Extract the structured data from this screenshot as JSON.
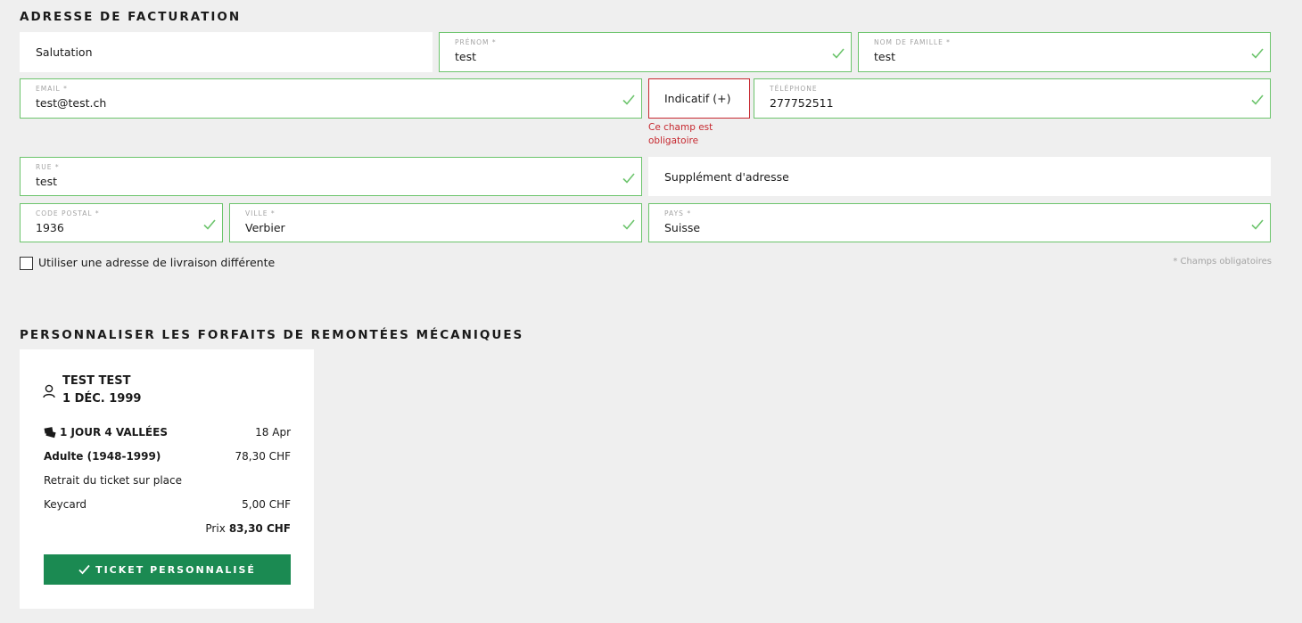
{
  "billing": {
    "title": "ADRESSE DE FACTURATION",
    "salutation": {
      "placeholder": "Salutation"
    },
    "first_name": {
      "label": "PRÉNOM *",
      "value": "test"
    },
    "last_name": {
      "label": "NOM DE FAMILLE *",
      "value": "test"
    },
    "email": {
      "label": "EMAIL *",
      "value": "test@test.ch"
    },
    "dial_code": {
      "placeholder": "Indicatif (+)",
      "error": "Ce champ est obligatoire"
    },
    "phone": {
      "label": "TÉLÉPHONE",
      "value": "277752511"
    },
    "street": {
      "label": "RUE *",
      "value": "test"
    },
    "address_supplement": {
      "placeholder": "Supplément d'adresse"
    },
    "postal_code": {
      "label": "CODE POSTAL *",
      "value": "1936"
    },
    "city": {
      "label": "VILLE *",
      "value": "Verbier"
    },
    "country": {
      "label": "PAYS *",
      "value": "Suisse"
    },
    "different_delivery_label": "Utiliser une adresse de livraison différente",
    "required_note": "* Champs obligatoires"
  },
  "passes": {
    "title": "PERSONNALISER LES FORFAITS DE REMONTÉES MÉCANIQUES",
    "card": {
      "person_name": "TEST TEST",
      "birth_date": "1 DÉC. 1999",
      "product": "1 JOUR 4 VALLÉES",
      "date": "18 Apr",
      "category": "Adulte (1948-1999)",
      "category_price": "78,30 CHF",
      "pickup": "Retrait du ticket sur place",
      "keycard": "Keycard",
      "keycard_price": "5,00 CHF",
      "total_label": "Prix",
      "total_value": "83,30 CHF",
      "button_label": "TICKET PERSONNALISÉ"
    }
  },
  "colors": {
    "valid_border": "#6cc46c",
    "error": "#c6282f",
    "button": "#1b8a52",
    "background": "#efefef"
  },
  "icons": [
    "check-icon",
    "user-icon",
    "ticket-icon"
  ]
}
